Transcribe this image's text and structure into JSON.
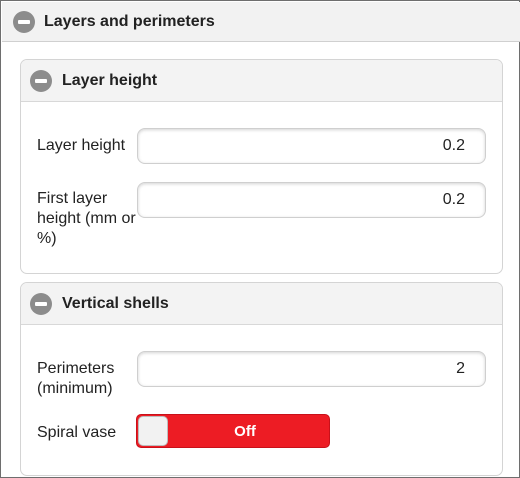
{
  "header": {
    "title": "Layers and perimeters",
    "icon": "minus-circle-icon"
  },
  "sections": [
    {
      "title": "Layer height",
      "icon": "minus-circle-icon",
      "fields": [
        {
          "label": "Layer height",
          "value": "0.2"
        },
        {
          "label": "First layer height (mm or %)",
          "value": "0.2"
        }
      ]
    },
    {
      "title": "Vertical shells",
      "icon": "minus-circle-icon",
      "fields": [
        {
          "label": "Perimeters (minimum)",
          "value": "2"
        }
      ],
      "toggle": {
        "label": "Spiral vase",
        "state": "Off",
        "color": "#ed1c24"
      }
    }
  ]
}
